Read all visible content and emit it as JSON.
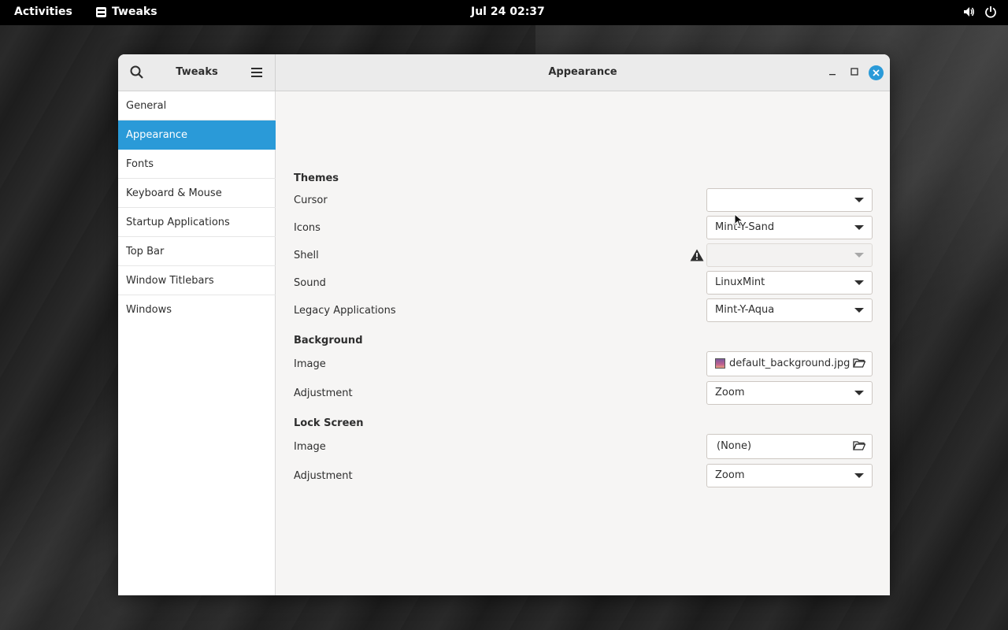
{
  "topbar": {
    "activities": "Activities",
    "app_name": "Tweaks",
    "clock": "Jul 24  02:37"
  },
  "window": {
    "sidebar_title": "Tweaks",
    "page_title": "Appearance",
    "accent_color": "#2a9ad8"
  },
  "sidebar": {
    "items": [
      {
        "label": "General"
      },
      {
        "label": "Appearance"
      },
      {
        "label": "Fonts"
      },
      {
        "label": "Keyboard & Mouse"
      },
      {
        "label": "Startup Applications"
      },
      {
        "label": "Top Bar"
      },
      {
        "label": "Window Titlebars"
      },
      {
        "label": "Windows"
      }
    ],
    "selected": "Appearance"
  },
  "themes": {
    "heading": "Themes",
    "cursor": {
      "label": "Cursor",
      "value": ""
    },
    "icons": {
      "label": "Icons",
      "value": "Mint-Y-Sand"
    },
    "shell": {
      "label": "Shell",
      "value": ""
    },
    "sound": {
      "label": "Sound",
      "value": "LinuxMint"
    },
    "legacy": {
      "label": "Legacy Applications",
      "value": "Mint-Y-Aqua"
    }
  },
  "background": {
    "heading": "Background",
    "image": {
      "label": "Image",
      "value": "default_background.jpg"
    },
    "adjustment": {
      "label": "Adjustment",
      "value": "Zoom"
    }
  },
  "lock_screen": {
    "heading": "Lock Screen",
    "image": {
      "label": "Image",
      "value": "(None)"
    },
    "adjustment": {
      "label": "Adjustment",
      "value": "Zoom"
    }
  }
}
